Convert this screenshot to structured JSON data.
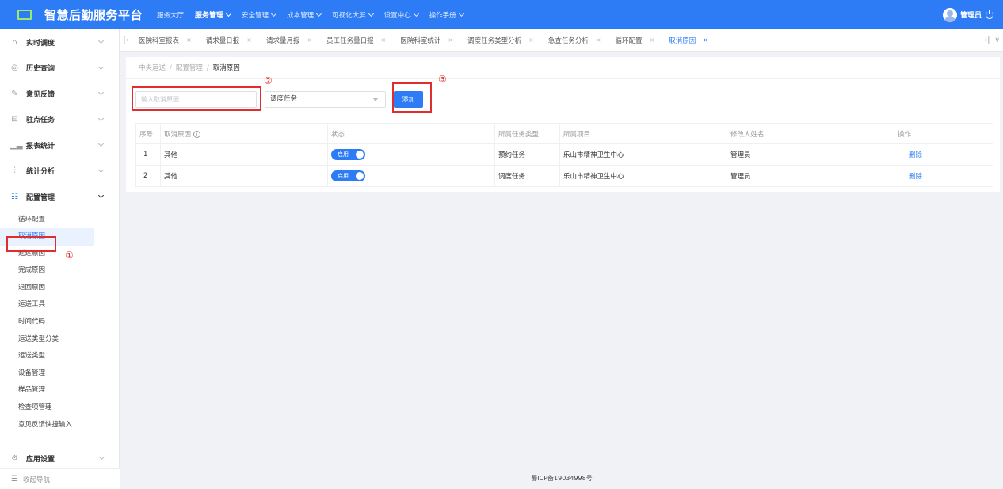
{
  "app": {
    "title": "智慧后勤服务平台"
  },
  "topnav": [
    {
      "label": "服务大厅",
      "caret": false,
      "active": false
    },
    {
      "label": "服务管理",
      "caret": true,
      "active": true
    },
    {
      "label": "安全管理",
      "caret": true,
      "active": false
    },
    {
      "label": "成本管理",
      "caret": true,
      "active": false
    },
    {
      "label": "可视化大屏",
      "caret": true,
      "active": false
    },
    {
      "label": "设置中心",
      "caret": true,
      "active": false
    },
    {
      "label": "操作手册",
      "caret": true,
      "active": false
    }
  ],
  "user": {
    "name": "管理员"
  },
  "sidebar": {
    "menus": [
      {
        "label": "实时调度",
        "icon": "home-icon"
      },
      {
        "label": "历史查询",
        "icon": "history-icon"
      },
      {
        "label": "意见反馈",
        "icon": "feedback-icon"
      },
      {
        "label": "驻点任务",
        "icon": "task-icon"
      },
      {
        "label": "报表统计",
        "icon": "report-icon"
      },
      {
        "label": "统计分析",
        "icon": "analysis-icon"
      },
      {
        "label": "配置管理",
        "icon": "config-icon"
      }
    ],
    "config_items": [
      "循环配置",
      "取消原因",
      "延迟原因",
      "完成原因",
      "退回原因",
      "运送工具",
      "时间代码",
      "运送类型分类",
      "运送类型",
      "设备管理",
      "样品管理",
      "检查项管理",
      "意见反馈快捷输入"
    ],
    "app_settings": "应用设置",
    "collapse_label": "收起导航"
  },
  "tabs": [
    "医院科室报表",
    "请求量日报",
    "请求量月报",
    "员工任务量日报",
    "医院科室统计",
    "调度任务类型分析",
    "急查任务分析",
    "循环配置",
    "取消原因"
  ],
  "breadcrumb": [
    "中央运送",
    "配置管理",
    "取消原因"
  ],
  "form": {
    "reason_placeholder": "输入取消原因",
    "task_type": "调度任务",
    "add_label": "添加"
  },
  "annotations": [
    "①",
    "②",
    "③"
  ],
  "table": {
    "headers": [
      "序号",
      "取消原因",
      "状态",
      "所属任务类型",
      "所属项目",
      "修改人姓名",
      "操作"
    ],
    "rows": [
      {
        "index": "1",
        "reason": "其他",
        "status": "启用",
        "task_type": "预约任务",
        "project": "乐山市精神卫生中心",
        "modifier": "管理员",
        "action": "删除"
      },
      {
        "index": "2",
        "reason": "其他",
        "status": "启用",
        "task_type": "调度任务",
        "project": "乐山市精神卫生中心",
        "modifier": "管理员",
        "action": "删除"
      }
    ]
  },
  "footer": {
    "icp": "蜀ICP备19034998号"
  },
  "colors": {
    "primary": "#2d7cf6",
    "annotation": "#e02e2e",
    "logo": "#9be86a"
  }
}
